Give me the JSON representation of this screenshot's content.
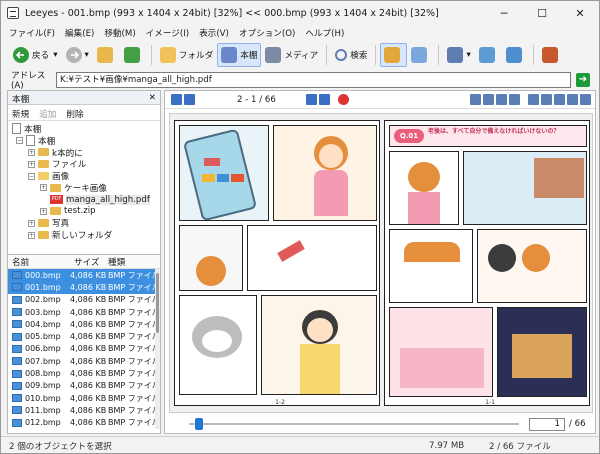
{
  "window": {
    "title": "Leeyes - 001.bmp (993 x 1404 x 24bit) [32%]   <<   000.bmp (993 x 1404 x 24bit) [32%]",
    "controls": [
      "─",
      "☐",
      "✕"
    ]
  },
  "menu": [
    "ファイル(F)",
    "編集(E)",
    "移動(M)",
    "イメージ(I)",
    "表示(V)",
    "オプション(O)",
    "ヘルプ(H)"
  ],
  "toolbar": {
    "back": "戻る",
    "folder": "フォルダ",
    "bookshelf": "本棚",
    "media": "メディア",
    "search": "検索"
  },
  "address": {
    "label": "アドレス(A)",
    "value": "K:¥テスト¥画像¥manga_all_high.pdf"
  },
  "left_panel": {
    "title": "本棚",
    "close": "✕",
    "tools": [
      "新規",
      "追加",
      "削除"
    ],
    "tree": [
      {
        "label": "本棚",
        "depth": 0
      },
      {
        "label": "本棚",
        "depth": 1
      },
      {
        "label": "k本的に",
        "depth": 2
      },
      {
        "label": "ファイル",
        "depth": 2
      },
      {
        "label": "画像",
        "depth": 2
      },
      {
        "label": "ケーキ画像",
        "depth": 3
      },
      {
        "label": "manga_all_high.pdf",
        "depth": 3
      },
      {
        "label": "test.zip",
        "depth": 3
      },
      {
        "label": "写真",
        "depth": 2
      },
      {
        "label": "新しいフォルダ",
        "depth": 2
      }
    ],
    "columns": [
      "名前",
      "サイズ",
      "種類"
    ],
    "files": [
      {
        "name": "000.bmp",
        "size": "4,086 KB",
        "type": "BMP ファイル",
        "selected": true
      },
      {
        "name": "001.bmp",
        "size": "4,086 KB",
        "type": "BMP ファイル",
        "selected": true
      },
      {
        "name": "002.bmp",
        "size": "4,086 KB",
        "type": "BMP ファイル"
      },
      {
        "name": "003.bmp",
        "size": "4,086 KB",
        "type": "BMP ファイル"
      },
      {
        "name": "004.bmp",
        "size": "4,086 KB",
        "type": "BMP ファイル"
      },
      {
        "name": "005.bmp",
        "size": "4,086 KB",
        "type": "BMP ファイル"
      },
      {
        "name": "006.bmp",
        "size": "4,086 KB",
        "type": "BMP ファイル"
      },
      {
        "name": "007.bmp",
        "size": "4,086 KB",
        "type": "BMP ファイル"
      },
      {
        "name": "008.bmp",
        "size": "4,086 KB",
        "type": "BMP ファイル"
      },
      {
        "name": "009.bmp",
        "size": "4,086 KB",
        "type": "BMP ファイル"
      },
      {
        "name": "010.bmp",
        "size": "4,086 KB",
        "type": "BMP ファイル"
      },
      {
        "name": "011.bmp",
        "size": "4,086 KB",
        "type": "BMP ファイル"
      },
      {
        "name": "012.bmp",
        "size": "4,086 KB",
        "type": "BMP ファイル"
      }
    ]
  },
  "viewer": {
    "page_indicator": "2 - 1 / 66",
    "left_page_no": "1-2",
    "right_page_no": "1-1",
    "q_label": "Q.01",
    "q_text": "老後は、すべて自分で備えなければいけないの？",
    "progress": 0.02,
    "page_box": "1",
    "page_total": "/ 66"
  },
  "status": {
    "left": "2 個のオブジェクトを選択",
    "size": "7.97 MB",
    "pages": "2 / 66 ファイル"
  }
}
